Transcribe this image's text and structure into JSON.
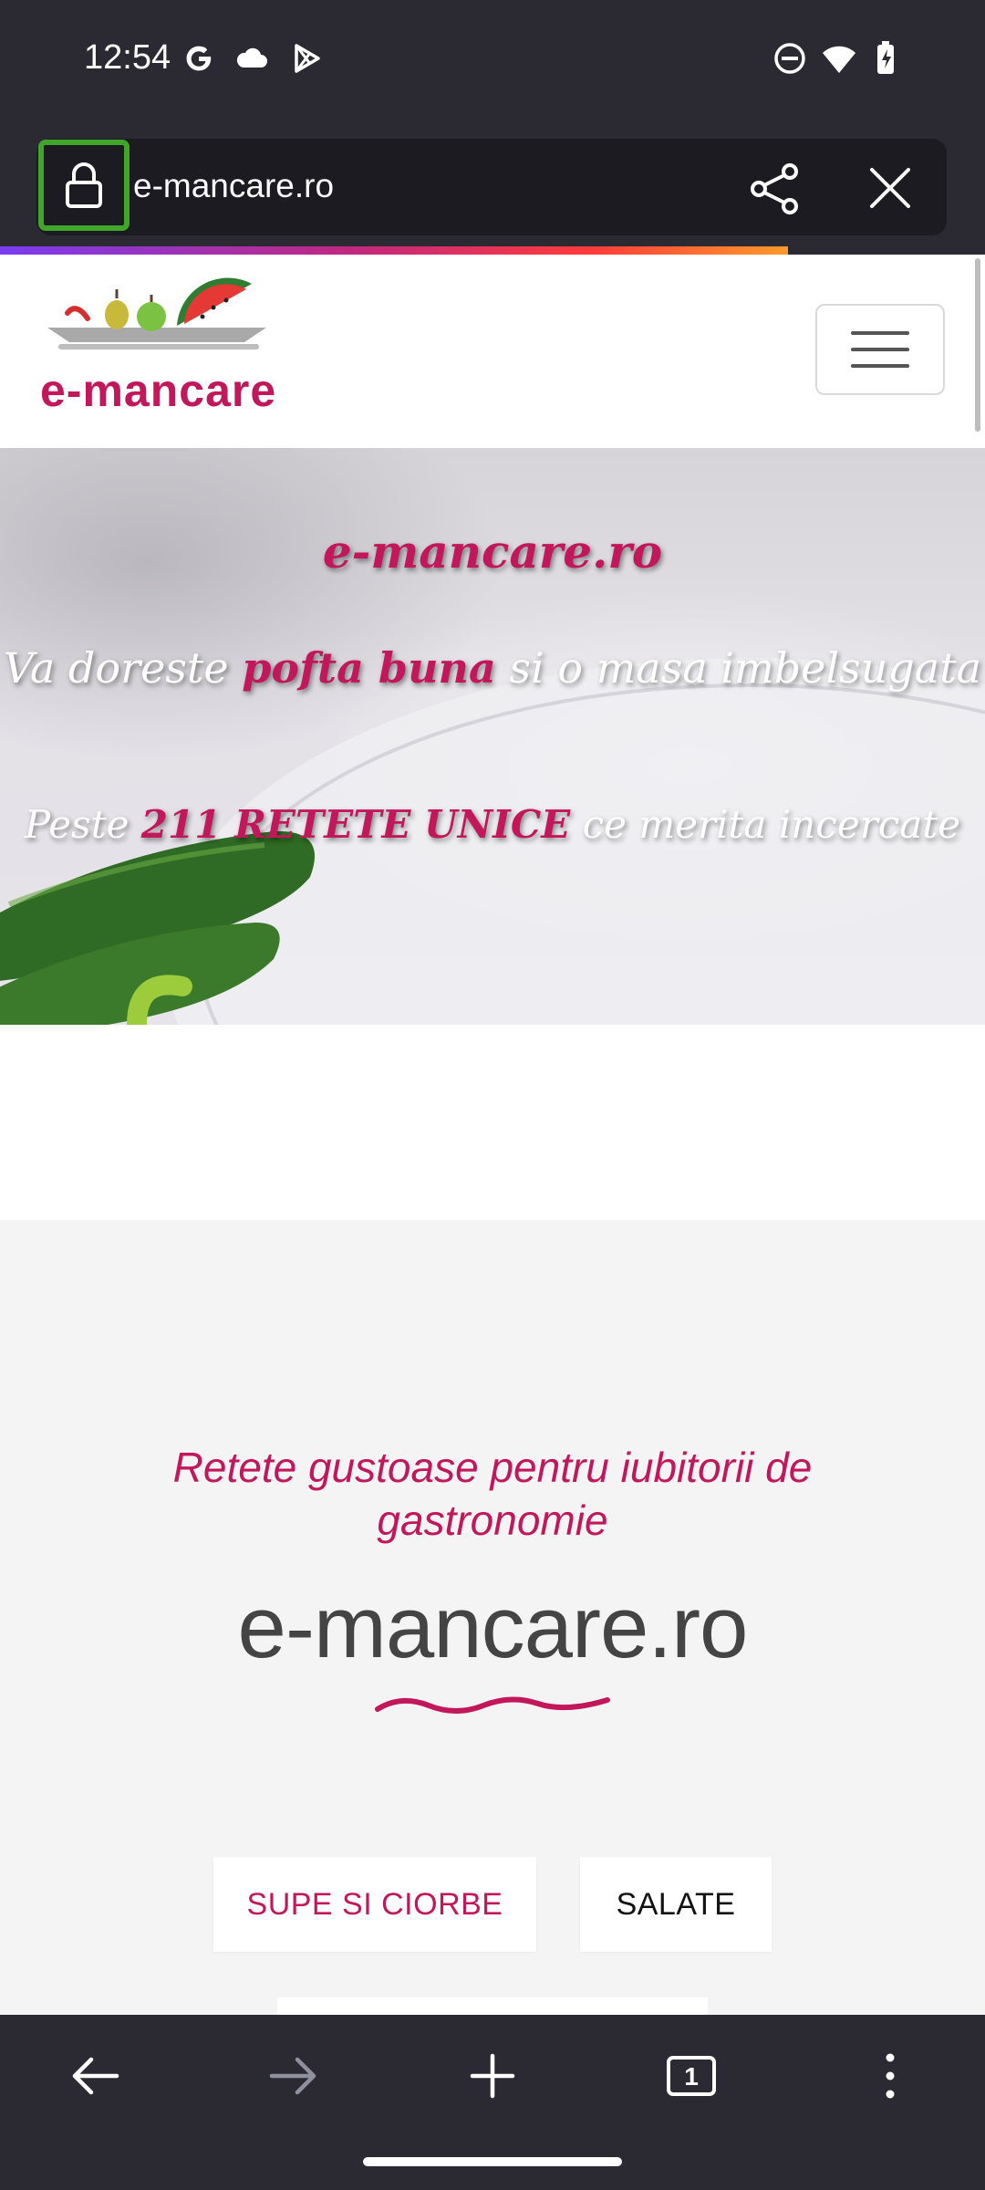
{
  "status_bar": {
    "time": "12:54",
    "icons": [
      "google-icon",
      "cloud-icon",
      "play-store-icon",
      "dnd-icon",
      "wifi-icon",
      "battery-charging-icon"
    ]
  },
  "browser": {
    "url": "e-mancare.ro",
    "icons": [
      "lock-icon",
      "share-icon",
      "close-icon"
    ],
    "bottom_nav_icons": [
      "back-arrow-icon",
      "forward-arrow-icon",
      "plus-icon",
      "tabs-icon",
      "more-icon"
    ],
    "tab_count": "1"
  },
  "site": {
    "logo_text": "e-mancare",
    "hero": {
      "title": "e-mancare.ro",
      "line2_part1": "Va doreste ",
      "line2_highlight": "pofta buna",
      "line2_part2": " si o masa imbelsugata",
      "line3_part1": "Peste ",
      "line3_highlight": "211 RETETE UNICE",
      "line3_part2": " ce merita incercate"
    },
    "tagline": "Retete gustoase pentru iubitorii de gastronomie",
    "big_title": "e-mancare.ro",
    "categories": [
      "SUPE SI CIORBE",
      "SALATE"
    ]
  },
  "colors": {
    "accent": "#c2185b",
    "toolbar": "#2b2a33",
    "lock_highlight": "#3fa62a"
  }
}
